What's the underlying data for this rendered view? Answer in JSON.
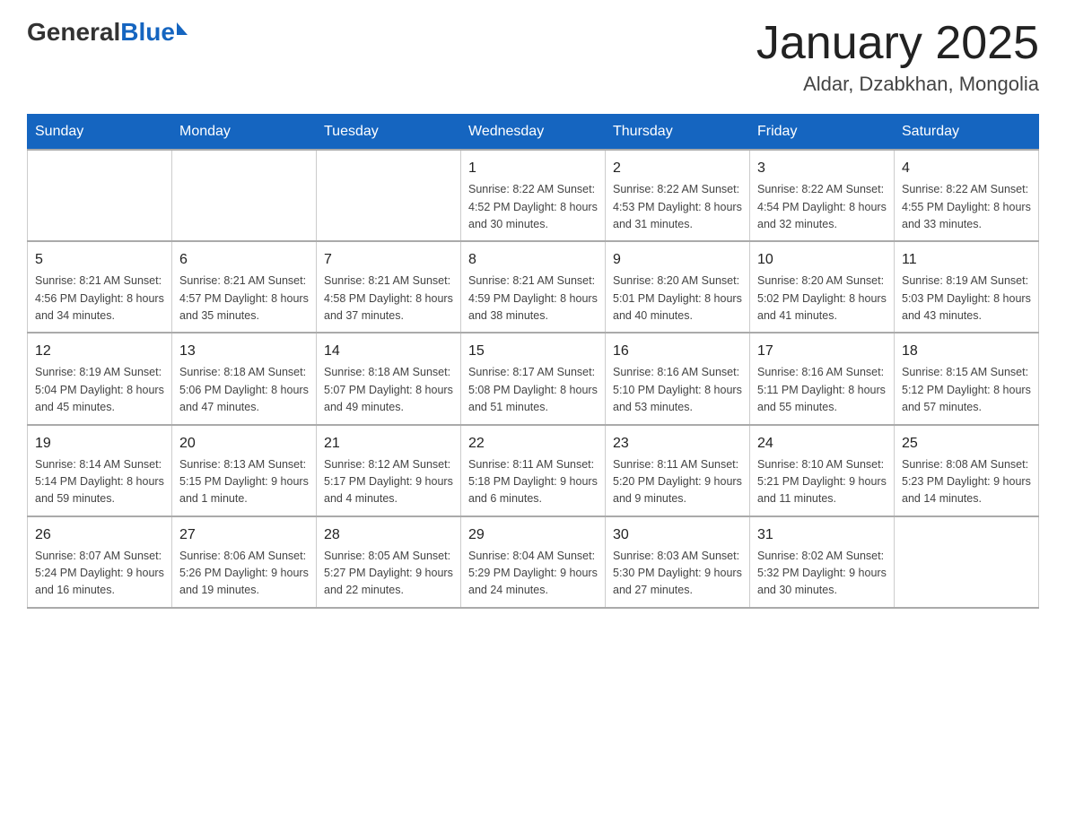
{
  "header": {
    "logo_general": "General",
    "logo_blue": "Blue",
    "month_title": "January 2025",
    "location": "Aldar, Dzabkhan, Mongolia"
  },
  "days_of_week": [
    "Sunday",
    "Monday",
    "Tuesday",
    "Wednesday",
    "Thursday",
    "Friday",
    "Saturday"
  ],
  "weeks": [
    [
      {
        "day": "",
        "info": ""
      },
      {
        "day": "",
        "info": ""
      },
      {
        "day": "",
        "info": ""
      },
      {
        "day": "1",
        "info": "Sunrise: 8:22 AM\nSunset: 4:52 PM\nDaylight: 8 hours\nand 30 minutes."
      },
      {
        "day": "2",
        "info": "Sunrise: 8:22 AM\nSunset: 4:53 PM\nDaylight: 8 hours\nand 31 minutes."
      },
      {
        "day": "3",
        "info": "Sunrise: 8:22 AM\nSunset: 4:54 PM\nDaylight: 8 hours\nand 32 minutes."
      },
      {
        "day": "4",
        "info": "Sunrise: 8:22 AM\nSunset: 4:55 PM\nDaylight: 8 hours\nand 33 minutes."
      }
    ],
    [
      {
        "day": "5",
        "info": "Sunrise: 8:21 AM\nSunset: 4:56 PM\nDaylight: 8 hours\nand 34 minutes."
      },
      {
        "day": "6",
        "info": "Sunrise: 8:21 AM\nSunset: 4:57 PM\nDaylight: 8 hours\nand 35 minutes."
      },
      {
        "day": "7",
        "info": "Sunrise: 8:21 AM\nSunset: 4:58 PM\nDaylight: 8 hours\nand 37 minutes."
      },
      {
        "day": "8",
        "info": "Sunrise: 8:21 AM\nSunset: 4:59 PM\nDaylight: 8 hours\nand 38 minutes."
      },
      {
        "day": "9",
        "info": "Sunrise: 8:20 AM\nSunset: 5:01 PM\nDaylight: 8 hours\nand 40 minutes."
      },
      {
        "day": "10",
        "info": "Sunrise: 8:20 AM\nSunset: 5:02 PM\nDaylight: 8 hours\nand 41 minutes."
      },
      {
        "day": "11",
        "info": "Sunrise: 8:19 AM\nSunset: 5:03 PM\nDaylight: 8 hours\nand 43 minutes."
      }
    ],
    [
      {
        "day": "12",
        "info": "Sunrise: 8:19 AM\nSunset: 5:04 PM\nDaylight: 8 hours\nand 45 minutes."
      },
      {
        "day": "13",
        "info": "Sunrise: 8:18 AM\nSunset: 5:06 PM\nDaylight: 8 hours\nand 47 minutes."
      },
      {
        "day": "14",
        "info": "Sunrise: 8:18 AM\nSunset: 5:07 PM\nDaylight: 8 hours\nand 49 minutes."
      },
      {
        "day": "15",
        "info": "Sunrise: 8:17 AM\nSunset: 5:08 PM\nDaylight: 8 hours\nand 51 minutes."
      },
      {
        "day": "16",
        "info": "Sunrise: 8:16 AM\nSunset: 5:10 PM\nDaylight: 8 hours\nand 53 minutes."
      },
      {
        "day": "17",
        "info": "Sunrise: 8:16 AM\nSunset: 5:11 PM\nDaylight: 8 hours\nand 55 minutes."
      },
      {
        "day": "18",
        "info": "Sunrise: 8:15 AM\nSunset: 5:12 PM\nDaylight: 8 hours\nand 57 minutes."
      }
    ],
    [
      {
        "day": "19",
        "info": "Sunrise: 8:14 AM\nSunset: 5:14 PM\nDaylight: 8 hours\nand 59 minutes."
      },
      {
        "day": "20",
        "info": "Sunrise: 8:13 AM\nSunset: 5:15 PM\nDaylight: 9 hours\nand 1 minute."
      },
      {
        "day": "21",
        "info": "Sunrise: 8:12 AM\nSunset: 5:17 PM\nDaylight: 9 hours\nand 4 minutes."
      },
      {
        "day": "22",
        "info": "Sunrise: 8:11 AM\nSunset: 5:18 PM\nDaylight: 9 hours\nand 6 minutes."
      },
      {
        "day": "23",
        "info": "Sunrise: 8:11 AM\nSunset: 5:20 PM\nDaylight: 9 hours\nand 9 minutes."
      },
      {
        "day": "24",
        "info": "Sunrise: 8:10 AM\nSunset: 5:21 PM\nDaylight: 9 hours\nand 11 minutes."
      },
      {
        "day": "25",
        "info": "Sunrise: 8:08 AM\nSunset: 5:23 PM\nDaylight: 9 hours\nand 14 minutes."
      }
    ],
    [
      {
        "day": "26",
        "info": "Sunrise: 8:07 AM\nSunset: 5:24 PM\nDaylight: 9 hours\nand 16 minutes."
      },
      {
        "day": "27",
        "info": "Sunrise: 8:06 AM\nSunset: 5:26 PM\nDaylight: 9 hours\nand 19 minutes."
      },
      {
        "day": "28",
        "info": "Sunrise: 8:05 AM\nSunset: 5:27 PM\nDaylight: 9 hours\nand 22 minutes."
      },
      {
        "day": "29",
        "info": "Sunrise: 8:04 AM\nSunset: 5:29 PM\nDaylight: 9 hours\nand 24 minutes."
      },
      {
        "day": "30",
        "info": "Sunrise: 8:03 AM\nSunset: 5:30 PM\nDaylight: 9 hours\nand 27 minutes."
      },
      {
        "day": "31",
        "info": "Sunrise: 8:02 AM\nSunset: 5:32 PM\nDaylight: 9 hours\nand 30 minutes."
      },
      {
        "day": "",
        "info": ""
      }
    ]
  ]
}
